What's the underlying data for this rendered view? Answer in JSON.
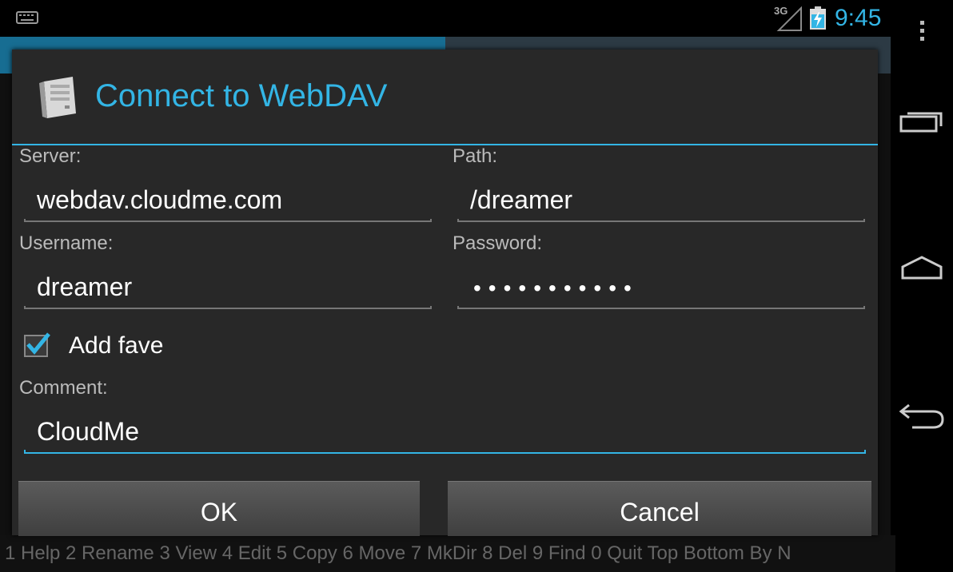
{
  "statusbar": {
    "network": "3G",
    "time": "9:45"
  },
  "background": {
    "keys_text": "1 Help  2 Rename  3 View  4 Edit  5 Copy  6 Move  7 MkDir  8 Del  9 Find  0 Quit  Top  Bottom  By N"
  },
  "dialog": {
    "title": "Connect to WebDAV",
    "server_label": "Server:",
    "server_value": "webdav.cloudme.com",
    "path_label": "Path:",
    "path_value": "/dreamer",
    "username_label": "Username:",
    "username_value": "dreamer",
    "password_label": "Password:",
    "password_masked": "•••••••••••",
    "add_fave_label": "Add fave",
    "add_fave_checked": true,
    "comment_label": "Comment:",
    "comment_value": "CloudMe",
    "ok_label": "OK",
    "cancel_label": "Cancel"
  },
  "colors": {
    "accent": "#33b5e5",
    "dialog_bg": "#282828",
    "field_line": "#777777"
  },
  "icons": [
    "keyboard-icon",
    "signal-3g-icon",
    "battery-charging-icon",
    "overflow-menu-icon",
    "recent-apps-icon",
    "home-icon",
    "back-icon",
    "server-icon",
    "checkbox-checked-icon"
  ]
}
